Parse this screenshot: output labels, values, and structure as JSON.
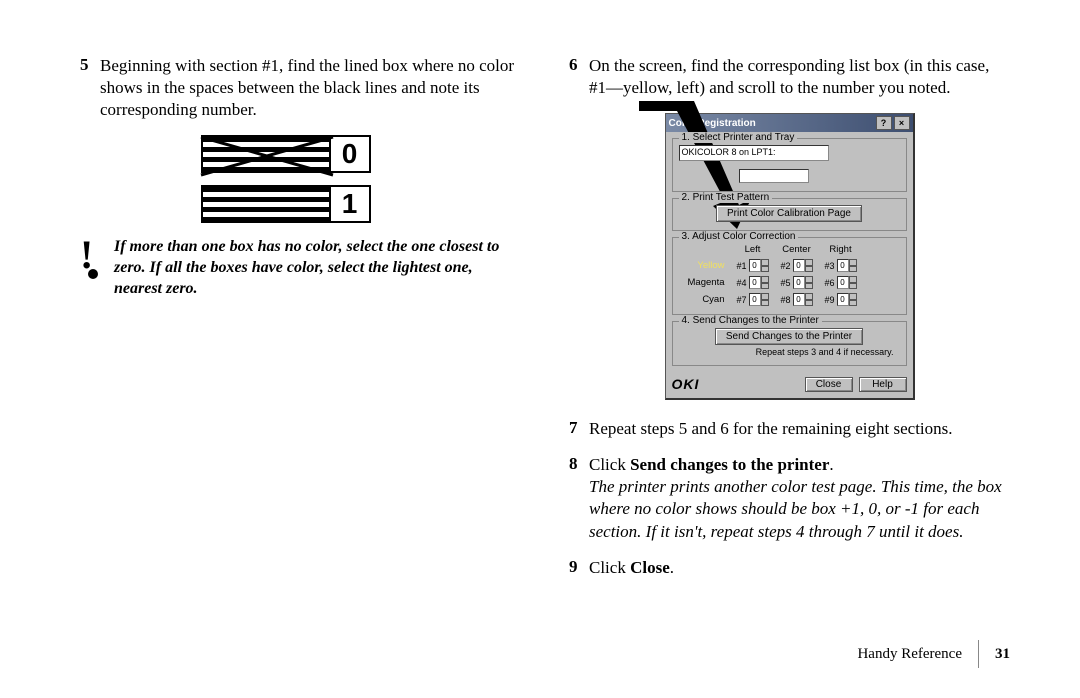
{
  "left": {
    "step5": {
      "num": "5",
      "text": "Beginning with section #1, find the lined box where no color shows in the spaces between the black lines and note its corresponding number."
    },
    "fig": {
      "box0": "0",
      "box1": "1"
    },
    "note": {
      "bang": "!",
      "text": "If more than one box has no color, select the one closest to zero. If all the boxes have color, select the lightest one, nearest zero."
    }
  },
  "right": {
    "step6": {
      "num": "6",
      "text": "On the screen, find the corresponding list box (in this case, #1—yellow, left) and scroll to the number you noted."
    },
    "step7": {
      "num": "7",
      "text": "Repeat steps 5 and 6 for the remaining eight sections."
    },
    "step8": {
      "num": "8",
      "click": "Click ",
      "bold": "Send changes to the printer",
      "dot": ".",
      "italic": "The printer prints another color test page. This time, the box where no color shows should be box +1, 0, or -1 for each section. If it isn't, repeat steps 4 through 7 until it does."
    },
    "step9": {
      "num": "9",
      "click": "Click ",
      "bold": "Close",
      "dot": "."
    }
  },
  "dialog": {
    "title": "Color Registration",
    "help": "?",
    "close": "×",
    "fs1": {
      "legend": "1. Select Printer and Tray",
      "sel": "OKICOLOR 8 on LPT1:"
    },
    "fs2": {
      "legend": "2. Print Test Pattern",
      "btn": "Print Color Calibration Page"
    },
    "fs3": {
      "legend": "3. Adjust Color Correction",
      "heads": {
        "left": "Left",
        "center": "Center",
        "right": "Right"
      },
      "rows": [
        {
          "label": "Yellow",
          "cells": [
            "#1",
            "#2",
            "#3"
          ]
        },
        {
          "label": "Magenta",
          "cells": [
            "#4",
            "#5",
            "#6"
          ]
        },
        {
          "label": "Cyan",
          "cells": [
            "#7",
            "#8",
            "#9"
          ]
        }
      ],
      "spinval": "0"
    },
    "fs4": {
      "legend": "4. Send Changes to the Printer",
      "btn": "Send Changes to the Printer",
      "hint": "Repeat steps 3 and 4 if necessary."
    },
    "oki": "OKI",
    "closebtn": "Close",
    "helpbtn": "Help"
  },
  "footer": {
    "section": "Handy Reference",
    "page": "31"
  }
}
